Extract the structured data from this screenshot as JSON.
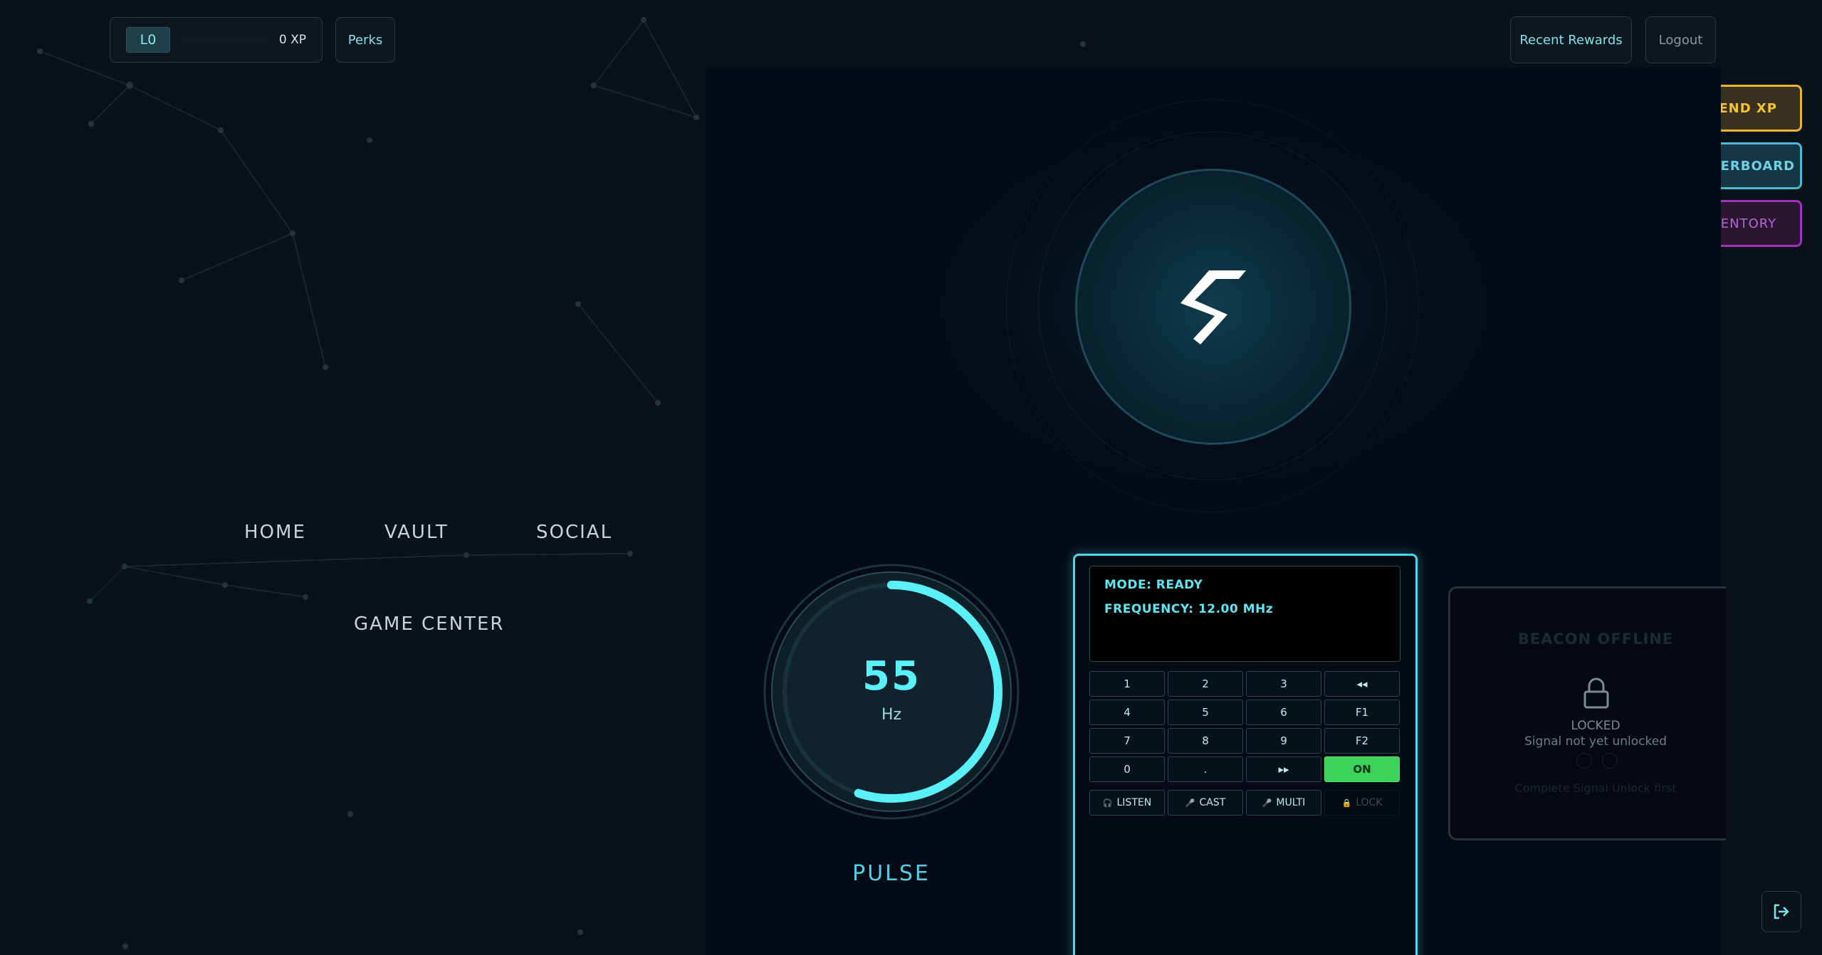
{
  "header": {
    "level_badge": "L0",
    "xp_progress": 0,
    "xp_text": "0 XP",
    "perks_label": "Perks",
    "recent_rewards_label": "Recent Rewards",
    "logout_label": "Logout"
  },
  "side_actions": {
    "spend_xp": {
      "icon": "diamond-icon",
      "label": "SPEND XP",
      "color": "#f4c433"
    },
    "leaderboard": {
      "icon": "plus-icon",
      "label": "LEADERBOARD",
      "color": "#6dd1e6"
    },
    "inventory": {
      "icon": "lightning-icon",
      "label": "INVENTORY",
      "color": "#b565cf"
    }
  },
  "nav": {
    "home": "HOME",
    "vault": "VAULT",
    "social": "SOCIAL",
    "game_center": "GAME CENTER"
  },
  "gauge": {
    "value": "55",
    "unit": "Hz",
    "label": "PULSE",
    "fill_fraction": 0.55,
    "accent": "#5af0f8"
  },
  "control_panel": {
    "screen": {
      "mode_line": "MODE: READY",
      "frequency_line": "FREQUENCY: 12.00 MHz"
    },
    "keys": [
      [
        "1",
        "2",
        "3",
        "◂◂"
      ],
      [
        "4",
        "5",
        "6",
        "F1"
      ],
      [
        "7",
        "8",
        "9",
        "F2"
      ],
      [
        "0",
        ".",
        "▸▸",
        "ON"
      ]
    ],
    "modes": [
      {
        "icon": "headphones-icon",
        "glyph": "🎧",
        "label": "LISTEN"
      },
      {
        "icon": "microphone-icon",
        "glyph": "🎤",
        "label": "CAST"
      },
      {
        "icon": "microphone-icon",
        "glyph": "🎤",
        "label": "MULTI"
      },
      {
        "icon": "lock-icon",
        "glyph": "🔒",
        "label": "LOCK"
      }
    ],
    "on_color": "#3bd15b"
  },
  "beacon": {
    "title": "BEACON OFFLINE",
    "locked": "LOCKED",
    "subtitle": "Signal not yet unlocked",
    "hint": "Complete Signal Unlock first"
  },
  "exit_icon": "exit-icon"
}
